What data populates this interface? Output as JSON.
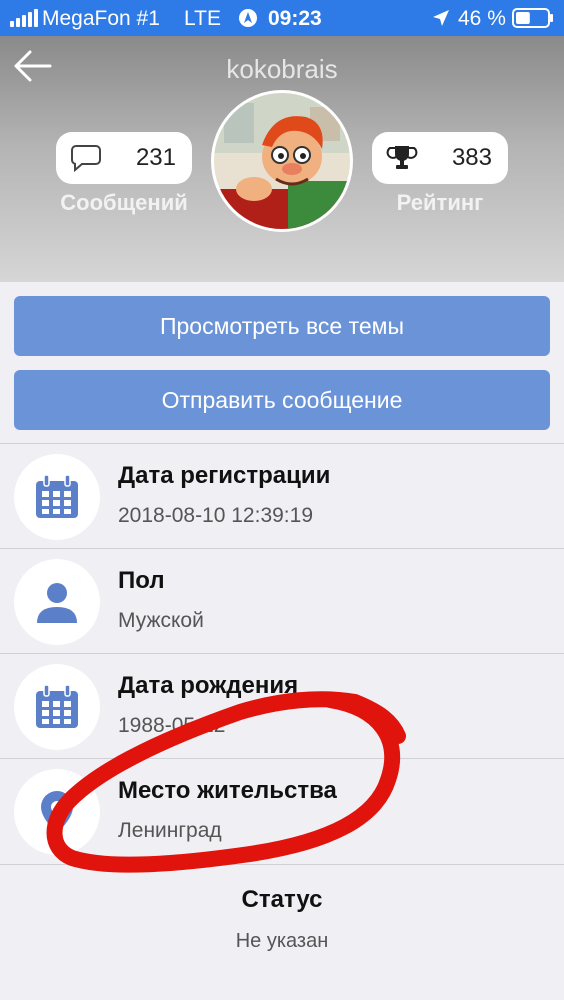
{
  "status_bar": {
    "carrier": "MegaFon #1",
    "network": "LTE",
    "time": "09:23",
    "battery": "46 %",
    "battery_level": 0.46
  },
  "header": {
    "username": "kokobrais",
    "messages_count": "231",
    "messages_label": "Сообщений",
    "rating_count": "383",
    "rating_label": "Рейтинг"
  },
  "actions": {
    "view_topics": "Просмотреть все темы",
    "send_message": "Отправить сообщение"
  },
  "info": [
    {
      "title": "Дата регистрации",
      "value": "2018-08-10 12:39:19",
      "icon": "calendar-icon"
    },
    {
      "title": "Пол",
      "value": "Мужской",
      "icon": "user-icon"
    },
    {
      "title": "Дата рождения",
      "value": "1988-05-22",
      "icon": "calendar-icon"
    },
    {
      "title": "Место жительства",
      "value": "Ленинград",
      "icon": "location-icon"
    }
  ],
  "status": {
    "title": "Статус",
    "value": "Не указан"
  },
  "colors": {
    "status_bar": "#2e7ae6",
    "button": "#6b94d8",
    "icon_blue": "#5b7fc8",
    "annotation": "#e0140c"
  }
}
